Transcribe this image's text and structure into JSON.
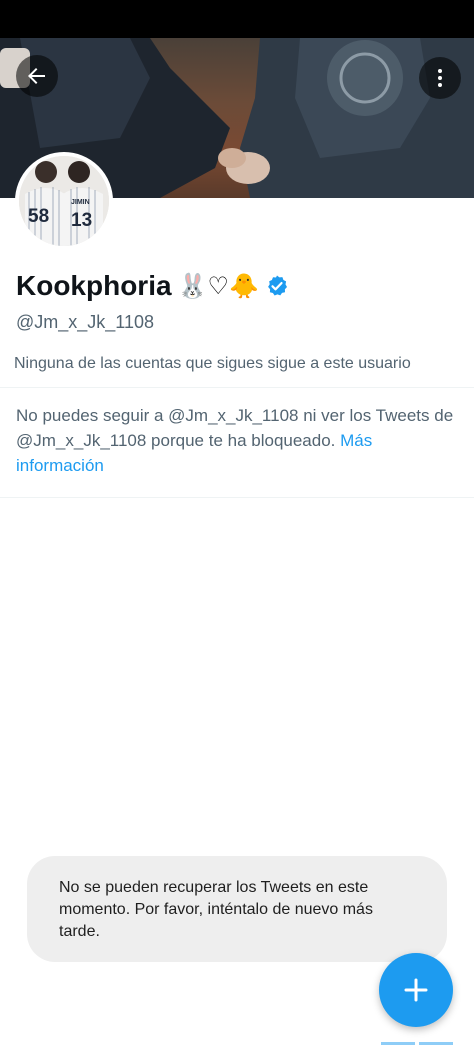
{
  "profile": {
    "display_name": "Kookphoria",
    "name_emojis": "🐰♡🐥",
    "handle": "@Jm_x_Jk_1108",
    "verified": true,
    "followers_you_know": "Ninguna de las cuentas que sigues sigue a este usuario",
    "avatar_jersey_left": "58",
    "avatar_jersey_right": "13",
    "avatar_jersey_right_name": "JIMIN"
  },
  "blocked": {
    "message_part1": "No puedes seguir a @Jm_x_Jk_1108 ni ver los Tweets de @Jm_x_Jk_1108 porque te ha bloqueado.",
    "learn_more": "Más información"
  },
  "toast": {
    "message": "No se pueden recuperar los Tweets en este momento. Por favor, inténtalo de nuevo más tarde."
  },
  "icons": {
    "back": "arrow-left-icon",
    "more": "more-vertical-icon",
    "compose": "plus-icon",
    "verified": "verified-badge-icon"
  },
  "colors": {
    "accent": "#1d9bf0",
    "text_primary": "#0f1419",
    "text_secondary": "#536471"
  }
}
